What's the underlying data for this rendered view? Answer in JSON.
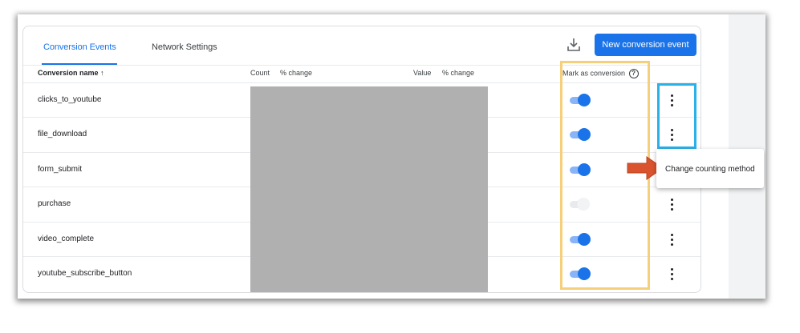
{
  "tabs": [
    {
      "label": "Conversion Events",
      "active": true
    },
    {
      "label": "Network Settings",
      "active": false
    }
  ],
  "toolbar": {
    "download_icon": "download-icon",
    "new_button_label": "New conversion event"
  },
  "table": {
    "headers": {
      "name": "Conversion name",
      "sort_icon": "↑",
      "count": "Count",
      "count_change": "% change",
      "value": "Value",
      "value_change": "% change",
      "mark": "Mark as conversion",
      "help_icon": "?"
    },
    "rows": [
      {
        "name": "clicks_to_youtube",
        "marked": true
      },
      {
        "name": "file_download",
        "marked": true
      },
      {
        "name": "form_submit",
        "marked": true
      },
      {
        "name": "purchase",
        "marked": false
      },
      {
        "name": "video_complete",
        "marked": true
      },
      {
        "name": "youtube_subscribe_button",
        "marked": true
      }
    ]
  },
  "menu": {
    "item": "Change counting method"
  },
  "colors": {
    "accent": "#1a73e8",
    "highlight_yellow": "#f6cf7b",
    "highlight_blue": "#2ab1e8",
    "arrow": "#d9542e",
    "redaction": "#b0b0b0"
  }
}
